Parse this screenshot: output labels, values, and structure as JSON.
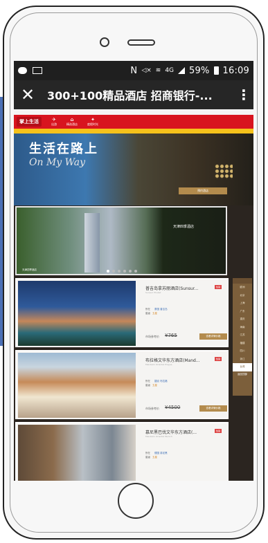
{
  "status_bar": {
    "left_icons": [
      "chat-icon",
      "mail-icon"
    ],
    "network_label": "4G",
    "battery_percent": "59%",
    "time": "16:09"
  },
  "title_bar": {
    "close_glyph": "✕",
    "title": "300+100精品酒店 招商银行-...",
    "menu_glyph": "⋮"
  },
  "site": {
    "brand": "掌上生活",
    "nav": [
      {
        "icon": "✈",
        "label": "出游"
      },
      {
        "icon": "⌂",
        "label": "精选酒店"
      },
      {
        "icon": "✦",
        "label": "度假时光"
      }
    ],
    "hero": {
      "title": "生活在路上",
      "subtitle": "On My Way",
      "cta": "预约酒店"
    },
    "banner": {
      "title": "天津四季酒店",
      "caption": "天津四季酒店"
    },
    "hotels": [
      {
        "name": "普吉岛拿苏丽酒店(Sunsur...",
        "tag": "热销",
        "en": "Sunsuri Phuket",
        "location_label": "所在",
        "location": "泰国 普吉岛",
        "rating_label": "星级",
        "rating": "五星",
        "price_label": "市场参考价",
        "price": "¥765",
        "cta": "查看详情价格"
      },
      {
        "name": "布拉格文华东方酒店(Mand...",
        "tag": "热销",
        "en": "Mandarin Oriental Prague",
        "location_label": "所在",
        "location": "捷克 布拉格",
        "rating_label": "星级",
        "rating": "五星",
        "price_label": "市场参考价",
        "price": "¥4500",
        "cta": "查看详情价格"
      },
      {
        "name": "慕尼黑巴伐文华东方酒店(...",
        "tag": "热销",
        "en": "Mandarin Oriental Munich",
        "location_label": "所在",
        "location": "德国 慕尼黑",
        "rating_label": "星级",
        "rating": "五星"
      }
    ],
    "sidebar_items": [
      "欧洲",
      "北京",
      "上海",
      "广东",
      "重庆",
      "海南",
      "江苏",
      "福建",
      "四川",
      "浙江",
      "台湾"
    ],
    "sidebar_foot": "返回顶部"
  },
  "colors": {
    "brand_red": "#d8141f",
    "accent_gold": "#b38b4d",
    "yellow_bar": "#f6c21b",
    "sidebar_brown": "#7c5f3b"
  }
}
